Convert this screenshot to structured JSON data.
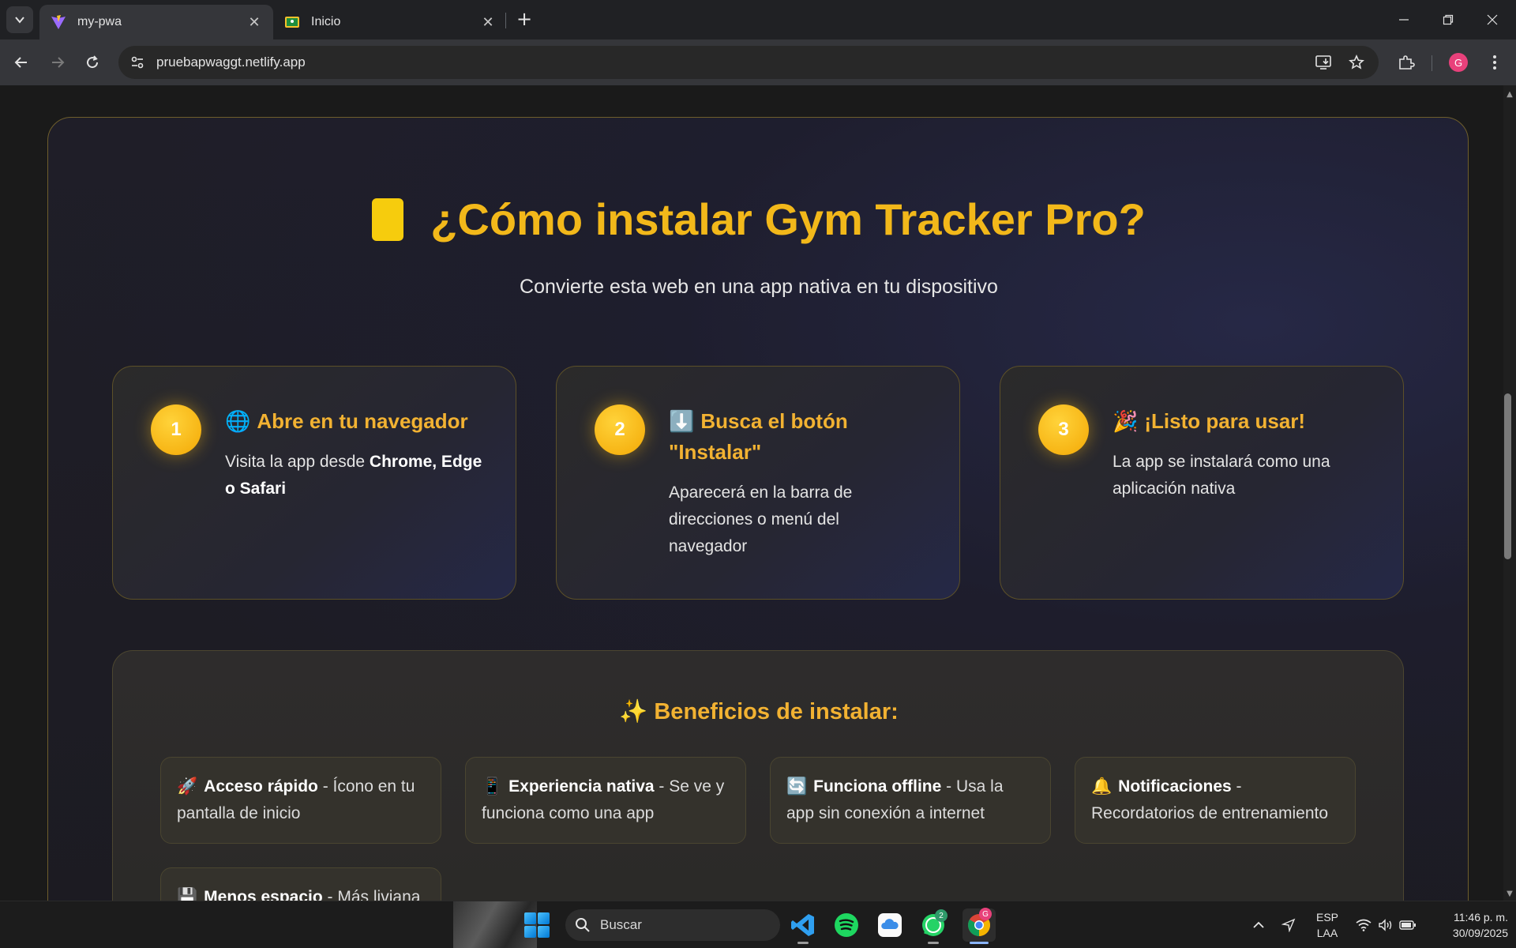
{
  "browser": {
    "tabs": [
      {
        "title": "my-pwa",
        "active": true
      },
      {
        "title": "Inicio",
        "active": false
      }
    ],
    "url": "pruebapwaggt.netlify.app",
    "profile_initial": "G"
  },
  "page": {
    "title": "¿Cómo instalar Gym Tracker Pro?",
    "subtitle": "Convierte esta web en una app nativa en tu dispositivo",
    "steps": [
      {
        "number": "1",
        "emoji": "🌐",
        "title": "Abre en tu navegador",
        "desc_prefix": "Visita la app desde ",
        "desc_bold": "Chrome, Edge o Safari"
      },
      {
        "number": "2",
        "emoji": "⬇️",
        "title": "Busca el botón \"Instalar\"",
        "desc": "Aparecerá en la barra de direcciones o menú del navegador"
      },
      {
        "number": "3",
        "emoji": "🎉",
        "title": "¡Listo para usar!",
        "desc": "La app se instalará como una aplicación nativa"
      }
    ],
    "benefits_title": "✨ Beneficios de instalar:",
    "benefits": [
      {
        "emoji": "🚀",
        "bold": "Acceso rápido",
        "text": " - Ícono en tu pantalla de inicio"
      },
      {
        "emoji": "📱",
        "bold": "Experiencia nativa",
        "text": " - Se ve y funciona como una app"
      },
      {
        "emoji": "🔄",
        "bold": "Funciona offline",
        "text": " - Usa la app sin conexión a internet"
      },
      {
        "emoji": "🔔",
        "bold": "Notificaciones",
        "text": " - Recordatorios de entrenamiento"
      },
      {
        "emoji": "💾",
        "bold": "Menos espacio",
        "text": " - Más liviana"
      }
    ]
  },
  "taskbar": {
    "search_label": "Buscar",
    "whatsapp_badge": "2",
    "chrome_badge": "G",
    "lang_line1": "ESP",
    "lang_line2": "LAA",
    "time": "11:46 p. m.",
    "date": "30/09/2025"
  },
  "colors": {
    "accent": "#f2b232",
    "title_yellow": "#f2b81a",
    "step_circle": "#fcc419",
    "page_bg": "#1a1a1a"
  }
}
